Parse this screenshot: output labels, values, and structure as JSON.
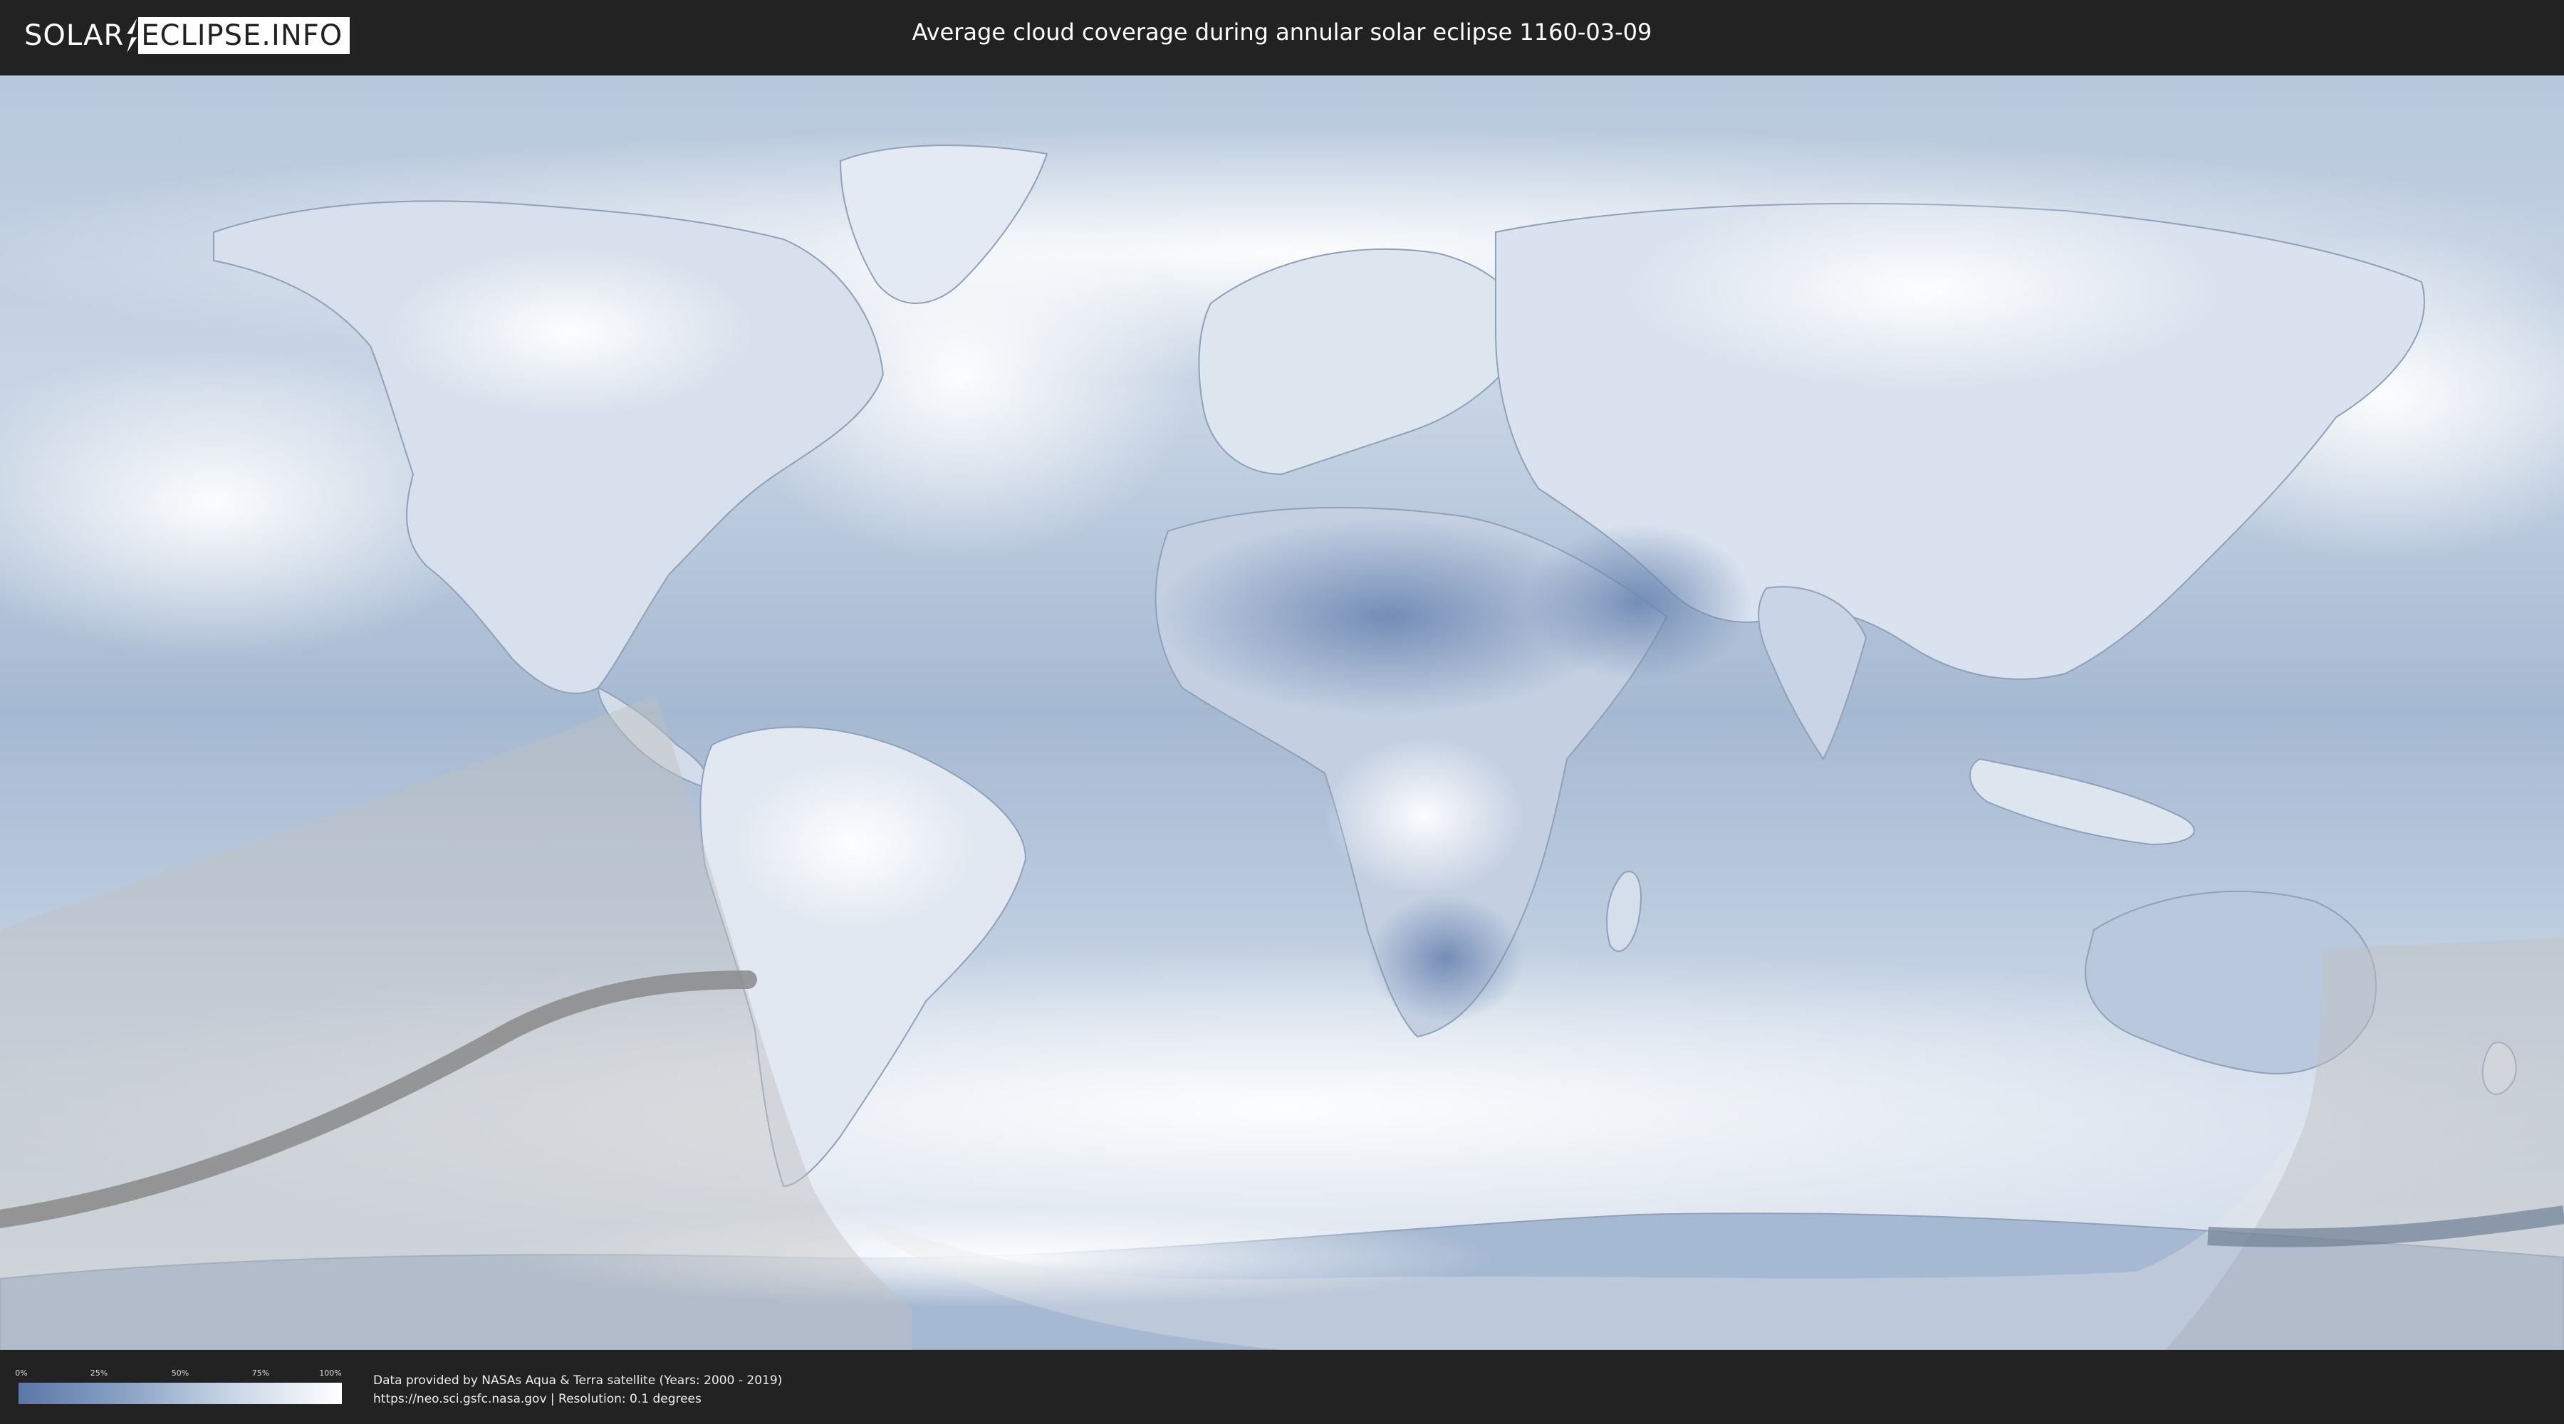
{
  "header": {
    "logo_left": "SOLAR",
    "logo_right": "ECLIPSE.INFO",
    "title": "Average cloud coverage during annular solar eclipse 1160-03-09"
  },
  "legend": {
    "ticks": [
      "0%",
      "25%",
      "50%",
      "75%",
      "100%"
    ],
    "colors": {
      "low": "#5b77a6",
      "high": "#ffffff"
    }
  },
  "credits": {
    "line1": "Data provided by NASAs Aqua & Terra satellite (Years: 2000 - 2019)",
    "line2": "https://neo.sci.gsfc.nasa.gov | Resolution: 0.1 degrees"
  },
  "map": {
    "ocean_color": "#a9bdd4",
    "land_color": "#dfe6f0",
    "cloud_color": "#ffffff",
    "eclipse_overlay_color": "#c8c8c8",
    "path_color": "#8a8a8a"
  }
}
